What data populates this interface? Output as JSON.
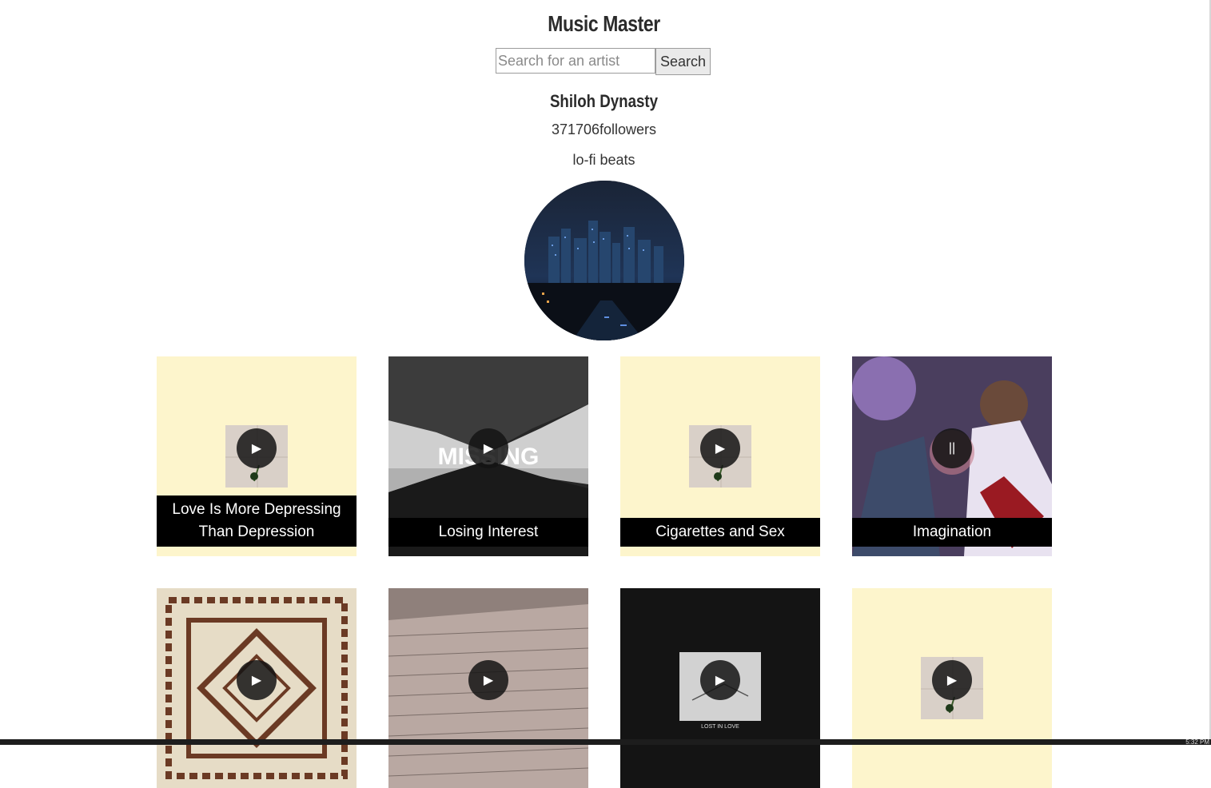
{
  "app": {
    "title": "Music Master"
  },
  "search": {
    "placeholder": "Search for an artist",
    "value": "",
    "button_label": "Search"
  },
  "artist": {
    "name": "Shiloh Dynasty",
    "followers": "371706followers",
    "genre": "lo-fi beats",
    "image_icon": "city-skyline-night"
  },
  "tracks": [
    {
      "title": "Love Is More Depressing Than Depression",
      "state": "play",
      "state_icon": "play-icon"
    },
    {
      "title": "Losing Interest",
      "state": "play",
      "state_icon": "play-icon",
      "cover_text": "MISSING"
    },
    {
      "title": "Cigarettes and Sex",
      "state": "play",
      "state_icon": "play-icon"
    },
    {
      "title": "Imagination",
      "state": "pause",
      "state_icon": "pause-icon"
    },
    {
      "title": "",
      "state": "play",
      "state_icon": "play-icon"
    },
    {
      "title": "",
      "state": "play",
      "state_icon": "play-icon"
    },
    {
      "title": "",
      "state": "play",
      "state_icon": "play-icon",
      "cover_text": "LOST IN LOVE"
    },
    {
      "title": "",
      "state": "play",
      "state_icon": "play-icon"
    }
  ],
  "glyphs": {
    "play": "▶",
    "pause": "||"
  },
  "taskbar": {
    "clock": "5:32 PM"
  }
}
